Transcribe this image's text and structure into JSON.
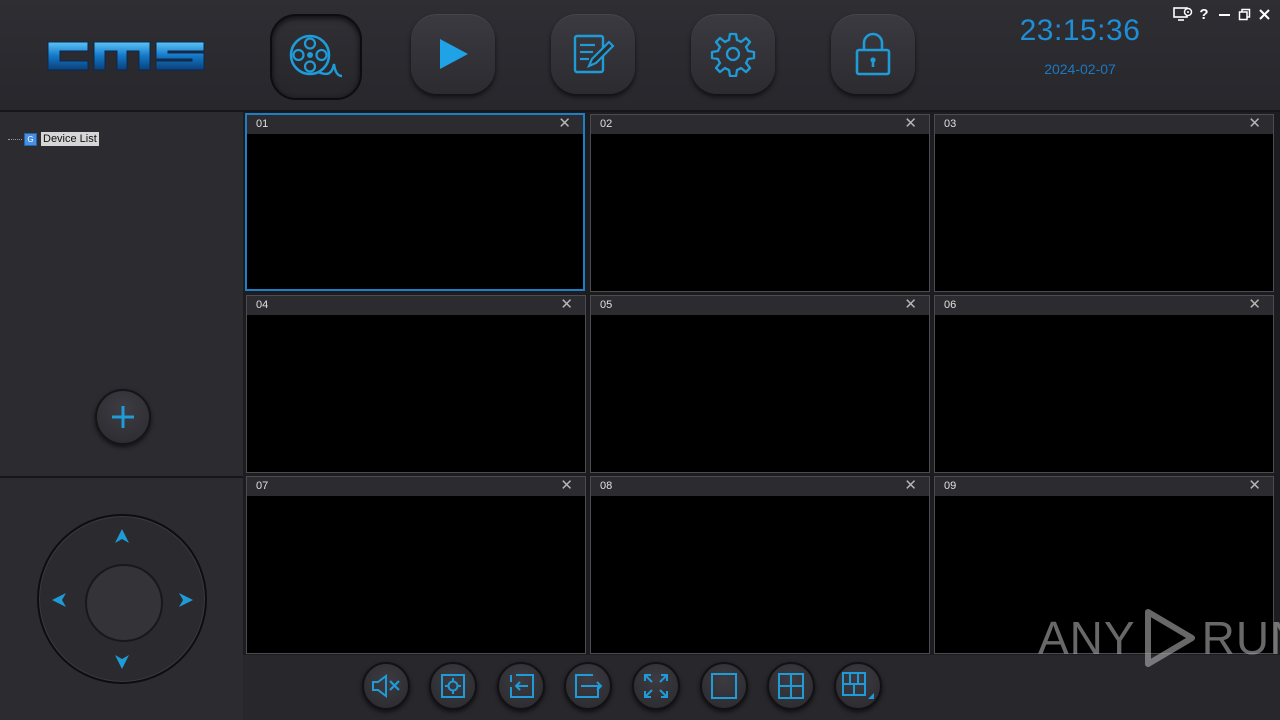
{
  "app": {
    "logo_text": "cms"
  },
  "nav": [
    {
      "name": "video-reel-icon",
      "label": "Live View",
      "active": true
    },
    {
      "name": "play-icon",
      "label": "Playback",
      "active": false
    },
    {
      "name": "edit-log-icon",
      "label": "Log",
      "active": false
    },
    {
      "name": "gear-icon",
      "label": "Settings",
      "active": false
    },
    {
      "name": "lock-icon",
      "label": "Lock",
      "active": false
    }
  ],
  "header": {
    "time": "23:15:36",
    "date": "2024-02-07"
  },
  "window_controls": [
    "monitor-settings-icon",
    "help-icon",
    "minimize-icon",
    "restore-icon",
    "close-icon"
  ],
  "sidebar": {
    "tree_root": {
      "icon_letter": "G",
      "label": "Device List"
    }
  },
  "cells": [
    {
      "num": "01",
      "selected": true
    },
    {
      "num": "02",
      "selected": false
    },
    {
      "num": "03",
      "selected": false
    },
    {
      "num": "04",
      "selected": false
    },
    {
      "num": "05",
      "selected": false
    },
    {
      "num": "06",
      "selected": false
    },
    {
      "num": "07",
      "selected": false
    },
    {
      "num": "08",
      "selected": false
    },
    {
      "num": "09",
      "selected": false
    }
  ],
  "toolbar": [
    "mute-icon",
    "snapshot-icon",
    "previous-page-icon",
    "next-page-icon",
    "fullscreen-icon",
    "single-layout-icon",
    "quad-layout-icon",
    "custom-layout-icon"
  ],
  "watermark": {
    "left": "ANY",
    "right": "RUN"
  },
  "colors": {
    "accent": "#1f9bd7",
    "background": "#26262b",
    "clock": "#1e8fd6"
  }
}
